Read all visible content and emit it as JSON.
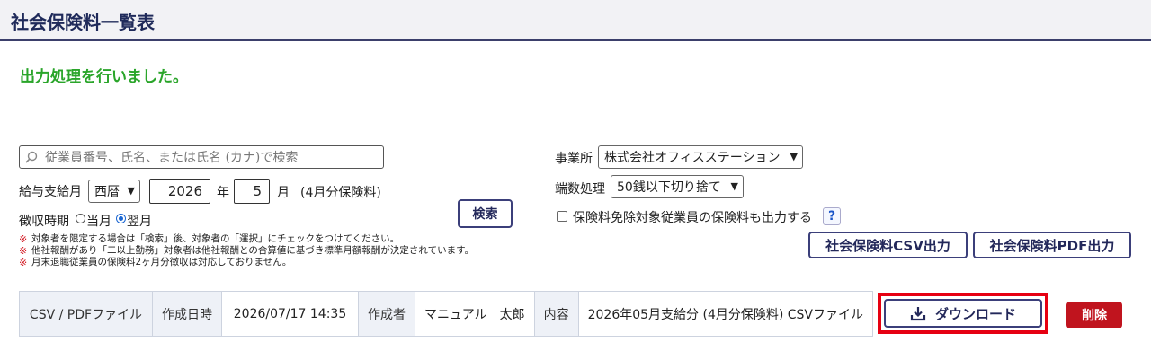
{
  "header": {
    "title": "社会保険料一覧表"
  },
  "message": {
    "success": "出力処理を行いました。"
  },
  "search": {
    "placeholder": "従業員番号、氏名、または氏名 (カナ)で検索",
    "button_label": "検索"
  },
  "pay_month": {
    "label": "給与支給月",
    "era_selected": "西暦",
    "year": "2026",
    "year_label": "年",
    "month": "5",
    "month_label": "月",
    "note": "(4月分保険料)"
  },
  "collection": {
    "label": "徴収時期",
    "options": [
      {
        "label": "当月",
        "selected": false
      },
      {
        "label": "翌月",
        "selected": true
      }
    ]
  },
  "notes": [
    "対象者を限定する場合は「検索」後、対象者の「選択」にチェックをつけてください。",
    "他社報酬があり「二以上勤務」対象者は他社報酬との合算値に基づき標準月額報酬が決定されています。",
    "月末退職従業員の保険料2ヶ月分徴収は対応しておりません。"
  ],
  "note_mark": "※",
  "office": {
    "label": "事業所",
    "selected": "株式会社オフィスステーション"
  },
  "rounding": {
    "label": "端数処理",
    "selected": "50銭以下切り捨て"
  },
  "exempt": {
    "label": "保険料免除対象従業員の保険料も出力する",
    "checked": false,
    "help": "?"
  },
  "actions": {
    "csv_label": "社会保険料CSV出力",
    "pdf_label": "社会保険料PDF出力"
  },
  "result": {
    "file_type": "CSV / PDFファイル",
    "created_label": "作成日時",
    "created_value": "2026/07/17 14:35",
    "author_label": "作成者",
    "author_value": "マニュアル　太郎",
    "content_label": "内容",
    "content_value": "2026年05月支給分 (4月分保険料) CSVファイル",
    "download_label": "ダウンロード",
    "delete_label": "削除"
  },
  "colors": {
    "success": "#2aa52a",
    "accent": "#3b3f7a",
    "highlight": "#e60012",
    "danger": "#c0141e"
  }
}
